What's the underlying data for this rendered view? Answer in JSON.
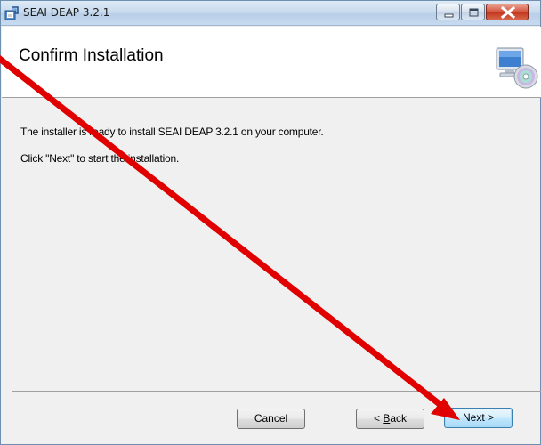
{
  "window": {
    "title": "SEAI DEAP 3.2.1"
  },
  "header": {
    "title": "Confirm Installation"
  },
  "content": {
    "line1": "The installer is ready to install SEAI DEAP 3.2.1 on your computer.",
    "line2": "Click \"Next\" to start the installation."
  },
  "buttons": {
    "cancel": "Cancel",
    "back_mnemonic": "B",
    "back_rest": "ack",
    "back_prefix": "< ",
    "next": "Next >"
  },
  "annotation": {
    "type": "red-arrow",
    "color": "#e00000",
    "points_to": "Next >"
  },
  "colors": {
    "title_bar": "#c9dbee",
    "dialog_background": "#f0f0f0",
    "banner_background": "#ffffff",
    "close_button": "#c2361d",
    "default_button_border": "#3c7fb1"
  },
  "icons": {
    "app": "installer-package-icon",
    "banner": "computer-with-disc-icon",
    "minimize": "minimize-icon",
    "maximize": "maximize-icon",
    "close": "close-icon"
  }
}
